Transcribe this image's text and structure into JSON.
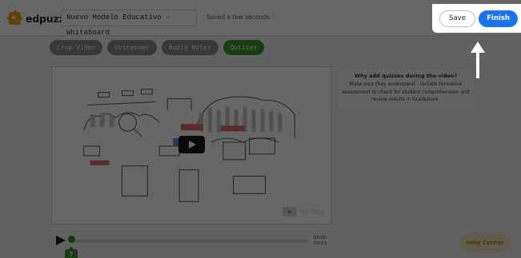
{
  "app": {
    "logo_text": "edpuzzle",
    "title_value": "Nuevo Modelo Educativo - Whiteboard",
    "save_status": "Saved a few seconds"
  },
  "tabs": [
    {
      "label": "Crop Video",
      "active": false
    },
    {
      "label": "Voiceover",
      "active": false
    },
    {
      "label": "Audio Notes",
      "active": false
    },
    {
      "label": "Quizzes",
      "active": true
    }
  ],
  "side_card": {
    "title": "Why add quizzes during the video?",
    "body": "Make sure they understand - include formative assessment to check for student comprehension and review results in Gradebook."
  },
  "player": {
    "youtube_label": "YouTube",
    "time_current": "00:00",
    "time_total": "03:33",
    "quiz_marker_label": "?",
    "progress": 0.0
  },
  "help": {
    "label": "Help Center"
  },
  "actions": {
    "save_label": "Save",
    "finish_label": "Finish"
  },
  "colors": {
    "accent_green": "#3e9a2a",
    "finish_blue": "#1a73e8",
    "logo_orange": "#f6a019",
    "overlay": "rgba(0,0,0,0.60)"
  },
  "icons": [
    "edpuzzle-logo-icon",
    "play-icon",
    "youtube-icon",
    "up-arrow-icon"
  ]
}
